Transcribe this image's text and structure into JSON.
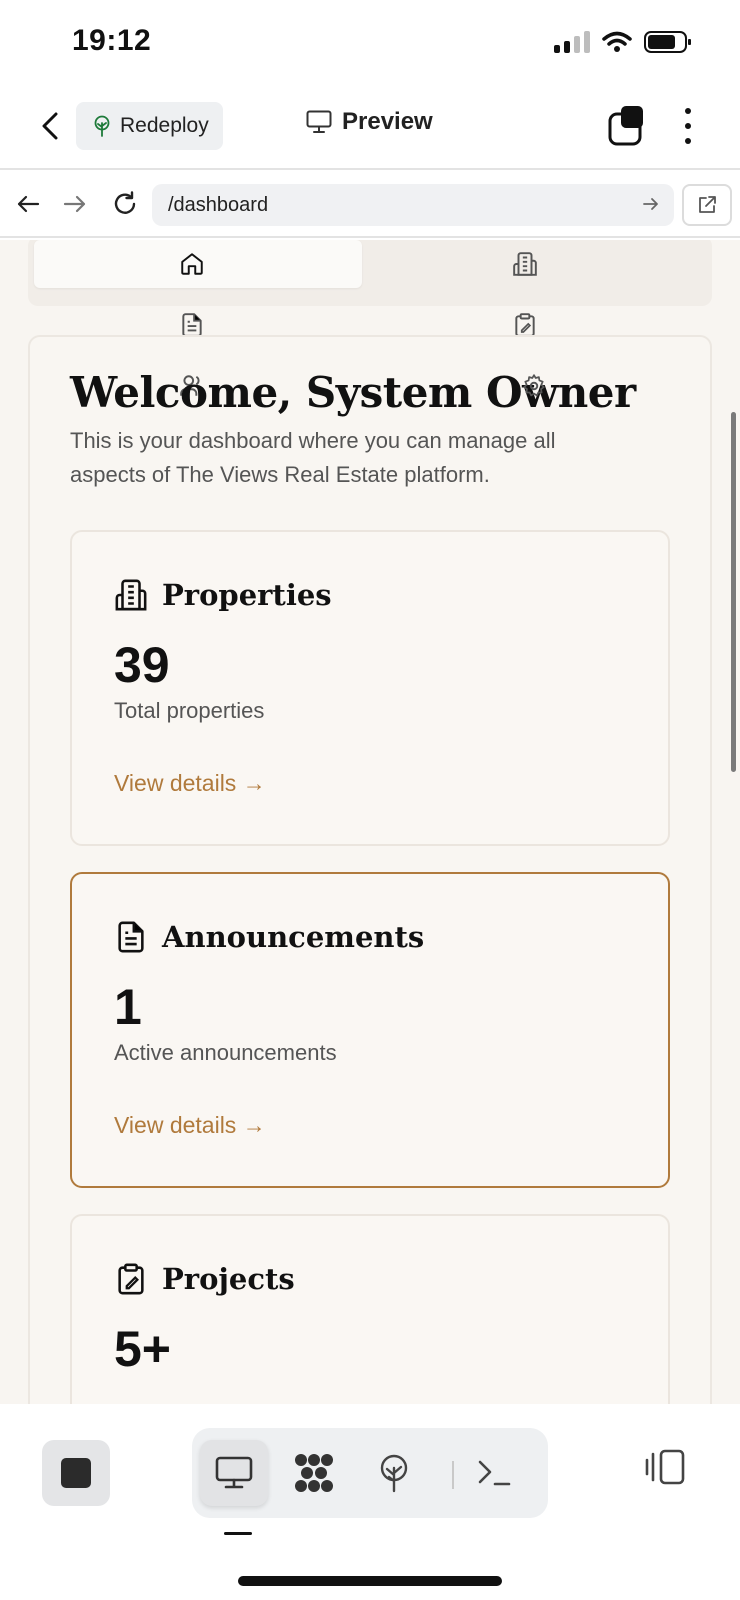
{
  "status_bar": {
    "time": "19:12"
  },
  "header": {
    "redeploy_label": "Redeploy",
    "title": "Preview"
  },
  "browser": {
    "url": "/dashboard"
  },
  "page": {
    "welcome_title": "Welcome, System Owner",
    "welcome_description": "This is your dashboard where you can manage all aspects of The Views Real Estate platform.",
    "nav_icons": [
      "home-icon",
      "building-icon",
      "document-icon",
      "clipboard-icon",
      "users-icon",
      "settings-icon"
    ],
    "cards": [
      {
        "title": "Properties",
        "value": "39",
        "label": "Total properties",
        "link": "View details →",
        "icon": "building-icon"
      },
      {
        "title": "Announcements",
        "value": "1",
        "label": "Active announcements",
        "link": "View details →",
        "icon": "document-icon"
      },
      {
        "title": "Projects",
        "value": "5+",
        "label": "",
        "link": "",
        "icon": "clipboard-icon"
      }
    ]
  },
  "colors": {
    "accent": "#b07a3c",
    "page_bg": "#f8f5f1",
    "card_border": "#ebe5de"
  },
  "toolbar": {
    "selected": "preview"
  }
}
